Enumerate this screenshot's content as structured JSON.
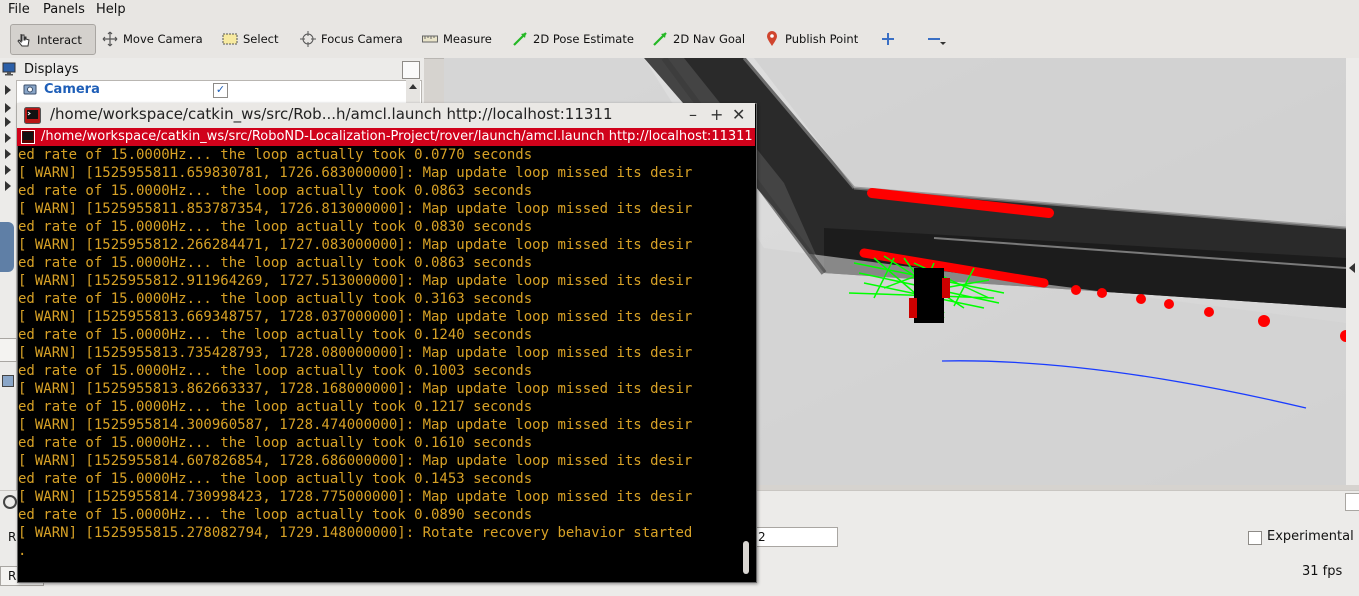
{
  "menu": {
    "file": "File",
    "panels": "Panels",
    "help": "Help"
  },
  "toolbar": {
    "interact": "Interact",
    "move_camera": "Move Camera",
    "select": "Select",
    "focus_camera": "Focus Camera",
    "measure": "Measure",
    "pose_estimate": "2D Pose Estimate",
    "nav_goal": "2D Nav Goal",
    "publish_point": "Publish Point"
  },
  "displays": {
    "title": "Displays",
    "first_item": "Camera"
  },
  "terminal": {
    "title": "/home/workspace/catkin_ws/src/Rob...h/amcl.launch http://localhost:11311",
    "tab": "/home/workspace/catkin_ws/src/RoboND-Localization-Project/rover/launch/amcl.launch http://localhost:11311",
    "lines": [
      "ed rate of 15.0000Hz... the loop actually took 0.0770 seconds",
      "[ WARN] [1525955811.659830781, 1726.683000000]: Map update loop missed its desir",
      "ed rate of 15.0000Hz... the loop actually took 0.0863 seconds",
      "[ WARN] [1525955811.853787354, 1726.813000000]: Map update loop missed its desir",
      "ed rate of 15.0000Hz... the loop actually took 0.0830 seconds",
      "[ WARN] [1525955812.266284471, 1727.083000000]: Map update loop missed its desir",
      "ed rate of 15.0000Hz... the loop actually took 0.0863 seconds",
      "[ WARN] [1525955812.911964269, 1727.513000000]: Map update loop missed its desir",
      "ed rate of 15.0000Hz... the loop actually took 0.3163 seconds",
      "[ WARN] [1525955813.669348757, 1728.037000000]: Map update loop missed its desir",
      "ed rate of 15.0000Hz... the loop actually took 0.1240 seconds",
      "[ WARN] [1525955813.735428793, 1728.080000000]: Map update loop missed its desir",
      "ed rate of 15.0000Hz... the loop actually took 0.1003 seconds",
      "[ WARN] [1525955813.862663337, 1728.168000000]: Map update loop missed its desir",
      "ed rate of 15.0000Hz... the loop actually took 0.1217 seconds",
      "[ WARN] [1525955814.300960587, 1728.474000000]: Map update loop missed its desir",
      "ed rate of 15.0000Hz... the loop actually took 0.1610 seconds",
      "[ WARN] [1525955814.607826854, 1728.686000000]: Map update loop missed its desir",
      "ed rate of 15.0000Hz... the loop actually took 0.1453 seconds",
      "[ WARN] [1525955814.730998423, 1728.775000000]: Map update loop missed its desir",
      "ed rate of 15.0000Hz... the loop actually took 0.0890 seconds",
      "[ WARN] [1525955815.278082794, 1729.148000000]: Rotate recovery behavior started",
      "."
    ]
  },
  "bottom": {
    "time_value": "2",
    "experimental": "Experimental",
    "fps": "31 fps",
    "left_cut_r": "R",
    "left_cut_re": "R"
  },
  "colors": {
    "terminal_text": "#d7a126",
    "terminal_tab": "#d0021b",
    "laser": "#ff0000",
    "particles": "#00ff00",
    "path": "#1a3cff"
  }
}
